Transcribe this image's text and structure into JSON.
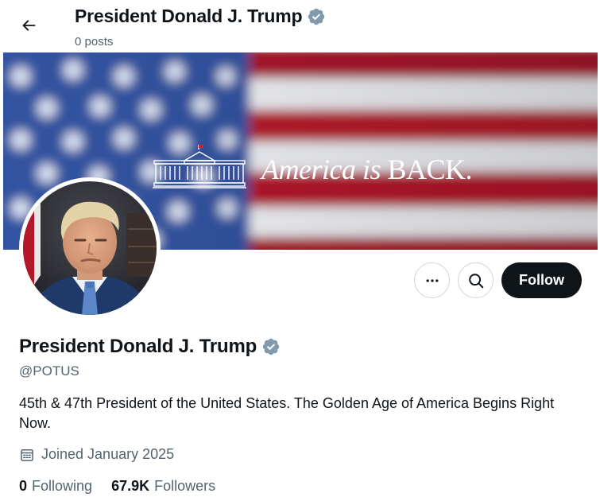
{
  "header": {
    "name": "President Donald J. Trump",
    "posts": "0 posts"
  },
  "banner": {
    "slogan_italic": "America is",
    "slogan_caps": " BACK."
  },
  "profile": {
    "name": "President Donald J. Trump",
    "handle": "@POTUS",
    "bio": "45th & 47th President of the United States. The Golden Age of America Begins Right Now.",
    "joined": "Joined January 2025",
    "following_count": "0",
    "following_label": "Following",
    "followers_count": "67.9K",
    "followers_label": "Followers"
  },
  "actions": {
    "follow_label": "Follow"
  },
  "icons": {
    "back": "arrow-left-icon",
    "verified": "verified-badge-icon",
    "more": "more-dots-icon",
    "search": "search-icon",
    "calendar": "calendar-icon"
  },
  "colors": {
    "verified_badge": "#829aab",
    "follow_bg": "#0f1419",
    "secondary_text": "#536471",
    "flag_red": "#b8182a",
    "flag_blue": "#2c4f9c"
  }
}
